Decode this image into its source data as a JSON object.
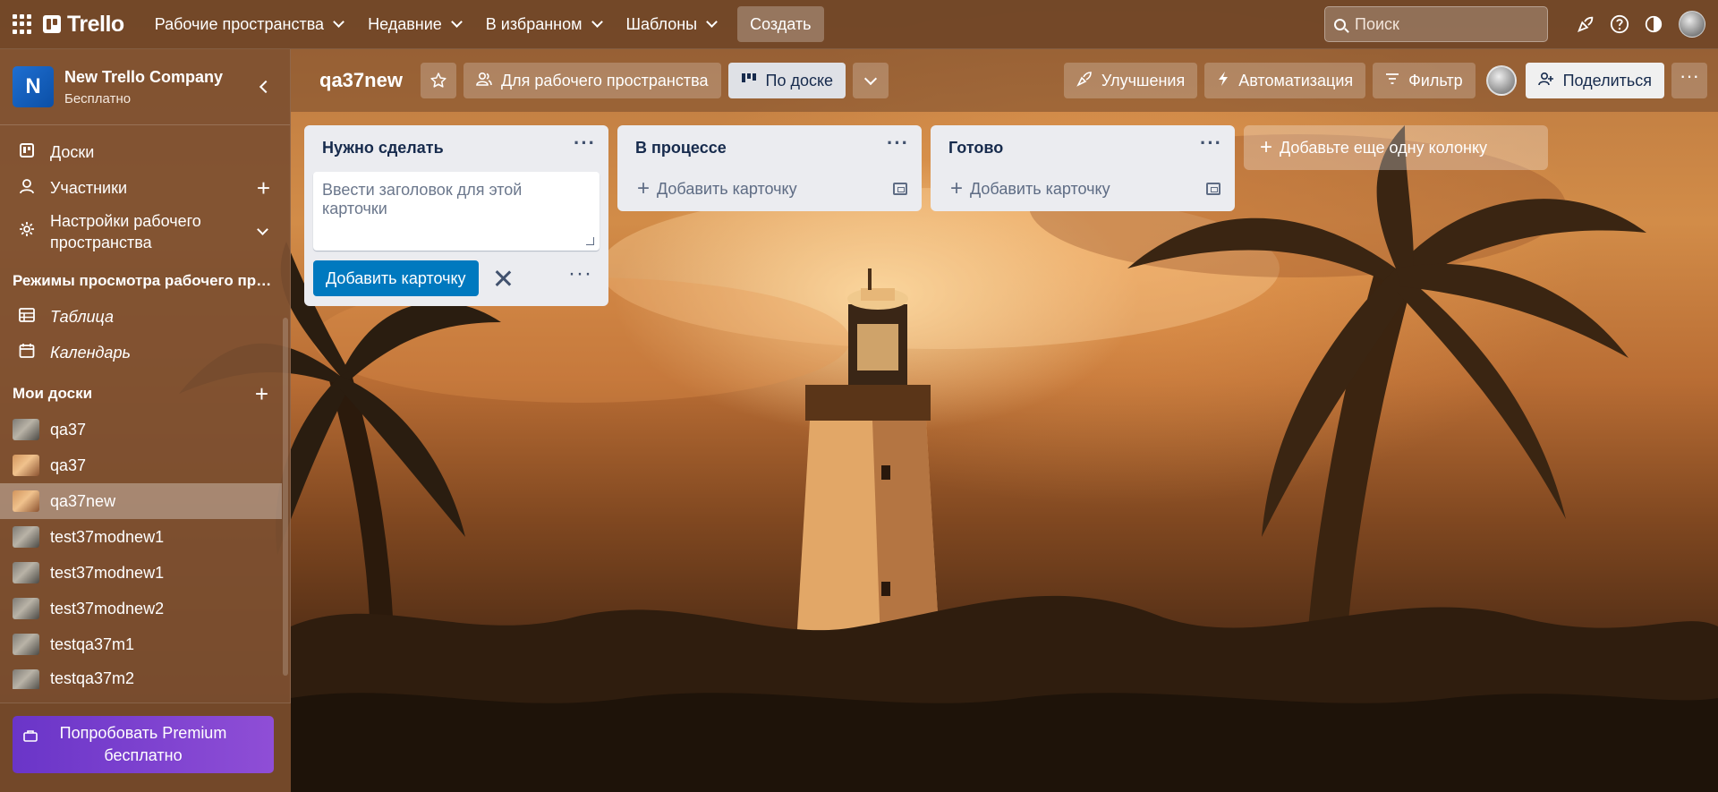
{
  "topbar": {
    "logo": "Trello",
    "nav": [
      {
        "label": "Рабочие пространства"
      },
      {
        "label": "Недавние"
      },
      {
        "label": "В избранном"
      },
      {
        "label": "Шаблоны"
      }
    ],
    "create_label": "Создать",
    "search_placeholder": "Поиск"
  },
  "sidebar": {
    "workspace": {
      "initial": "N",
      "name": "New Trello Company",
      "plan": "Бесплатно"
    },
    "items": [
      {
        "label": "Доски"
      },
      {
        "label": "Участники"
      },
      {
        "label": "Настройки рабочего пространства"
      }
    ],
    "views_title": "Режимы просмотра рабочего пространства",
    "views": [
      {
        "label": "Таблица"
      },
      {
        "label": "Календарь"
      }
    ],
    "boards_title": "Мои доски",
    "boards": [
      {
        "label": "qa37"
      },
      {
        "label": "qa37"
      },
      {
        "label": "qa37new"
      },
      {
        "label": "test37modnew1"
      },
      {
        "label": "test37modnew1"
      },
      {
        "label": "test37modnew2"
      },
      {
        "label": "testqa37m1"
      },
      {
        "label": "testqa37m2"
      }
    ],
    "premium_label": "Попробовать Premium бесплатно"
  },
  "board": {
    "title": "qa37new",
    "visibility_label": "Для рабочего пространства",
    "view_label": "По доске",
    "powerups_label": "Улучшения",
    "automation_label": "Автоматизация",
    "filter_label": "Фильтр",
    "share_label": "Поделиться"
  },
  "lists": [
    {
      "title": "Нужно сделать",
      "composer_placeholder": "Ввести заголовок для этой карточки",
      "add_button": "Добавить карточку"
    },
    {
      "title": "В процессе",
      "add_card": "Добавить карточку"
    },
    {
      "title": "Готово",
      "add_card": "Добавить карточку"
    }
  ],
  "add_list_label": "Добавьте еще одну колонку"
}
